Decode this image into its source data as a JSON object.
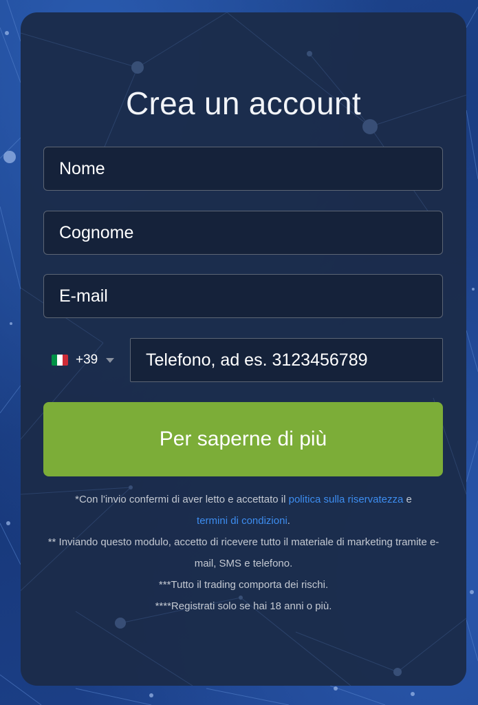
{
  "form": {
    "title": "Crea un account",
    "fields": {
      "first_name_placeholder": "Nome",
      "last_name_placeholder": "Cognome",
      "email_placeholder": "E-mail",
      "phone_placeholder": "Telefono, ad es. 3123456789"
    },
    "phone_country": {
      "flag": "italy-flag-icon",
      "dial_code": "+39",
      "flag_colors": [
        "#009246",
        "#ffffff",
        "#ce2b37"
      ]
    },
    "submit_label": "Per saperne di più"
  },
  "legal": {
    "line1_prefix": "*Con l'invio confermi di aver letto e accettato il ",
    "privacy_link": "politica sulla riservatezza",
    "line1_conj": " e",
    "terms_link": "termini di condizioni",
    "line1_end": ".",
    "line2": "** Inviando questo modulo, accetto di ricevere tutto il materiale di marketing tramite e-mail, SMS e telefono.",
    "line3": "***Tutto il trading comporta dei rischi.",
    "line4": "****Registrati solo se hai 18 anni o più."
  },
  "colors": {
    "background": "#1b3f86",
    "card": "#1b2c4a",
    "input_bg": "#15223a",
    "button": "#7cad38",
    "link": "#3d8df0"
  }
}
